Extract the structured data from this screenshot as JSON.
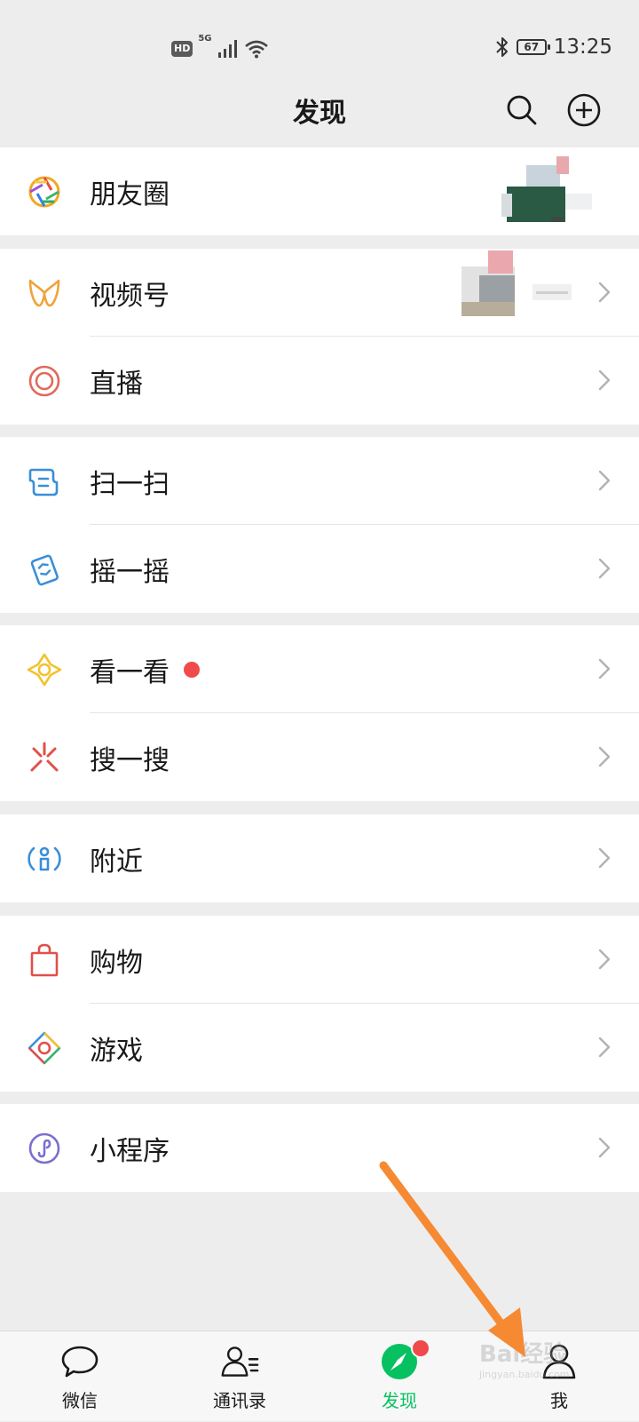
{
  "status_bar": {
    "hd": "HD",
    "network": "5G",
    "battery": "67",
    "time": "13:25"
  },
  "header": {
    "title": "发现",
    "search_icon": "search-icon",
    "add_icon": "plus-circle-icon"
  },
  "groups": [
    {
      "items": [
        {
          "label": "朋友圈",
          "icon": "aperture-icon"
        }
      ]
    },
    {
      "items": [
        {
          "label": "视频号",
          "icon": "channels-icon"
        },
        {
          "label": "直播",
          "icon": "live-icon"
        }
      ]
    },
    {
      "items": [
        {
          "label": "扫一扫",
          "icon": "scan-icon"
        },
        {
          "label": "摇一摇",
          "icon": "shake-icon"
        }
      ]
    },
    {
      "items": [
        {
          "label": "看一看",
          "icon": "top-stories-icon"
        },
        {
          "label": "搜一搜",
          "icon": "search-spark-icon"
        }
      ]
    },
    {
      "items": [
        {
          "label": "附近",
          "icon": "nearby-icon"
        }
      ]
    },
    {
      "items": [
        {
          "label": "购物",
          "icon": "shopping-bag-icon"
        },
        {
          "label": "游戏",
          "icon": "games-icon"
        }
      ]
    },
    {
      "items": [
        {
          "label": "小程序",
          "icon": "mini-program-icon"
        }
      ]
    }
  ],
  "tabs": [
    {
      "label": "微信",
      "icon": "chat-bubble-icon"
    },
    {
      "label": "通讯录",
      "icon": "contacts-icon"
    },
    {
      "label": "发现",
      "icon": "compass-icon",
      "active": true
    },
    {
      "label": "我",
      "icon": "person-icon"
    }
  ],
  "watermark": {
    "brand": "Bai经验",
    "url": "jingyan.baidu.com"
  },
  "colors": {
    "accent_green": "#07c160",
    "badge_red": "#f04a4a",
    "annotation_orange": "#f58a33",
    "background": "#ededed"
  }
}
